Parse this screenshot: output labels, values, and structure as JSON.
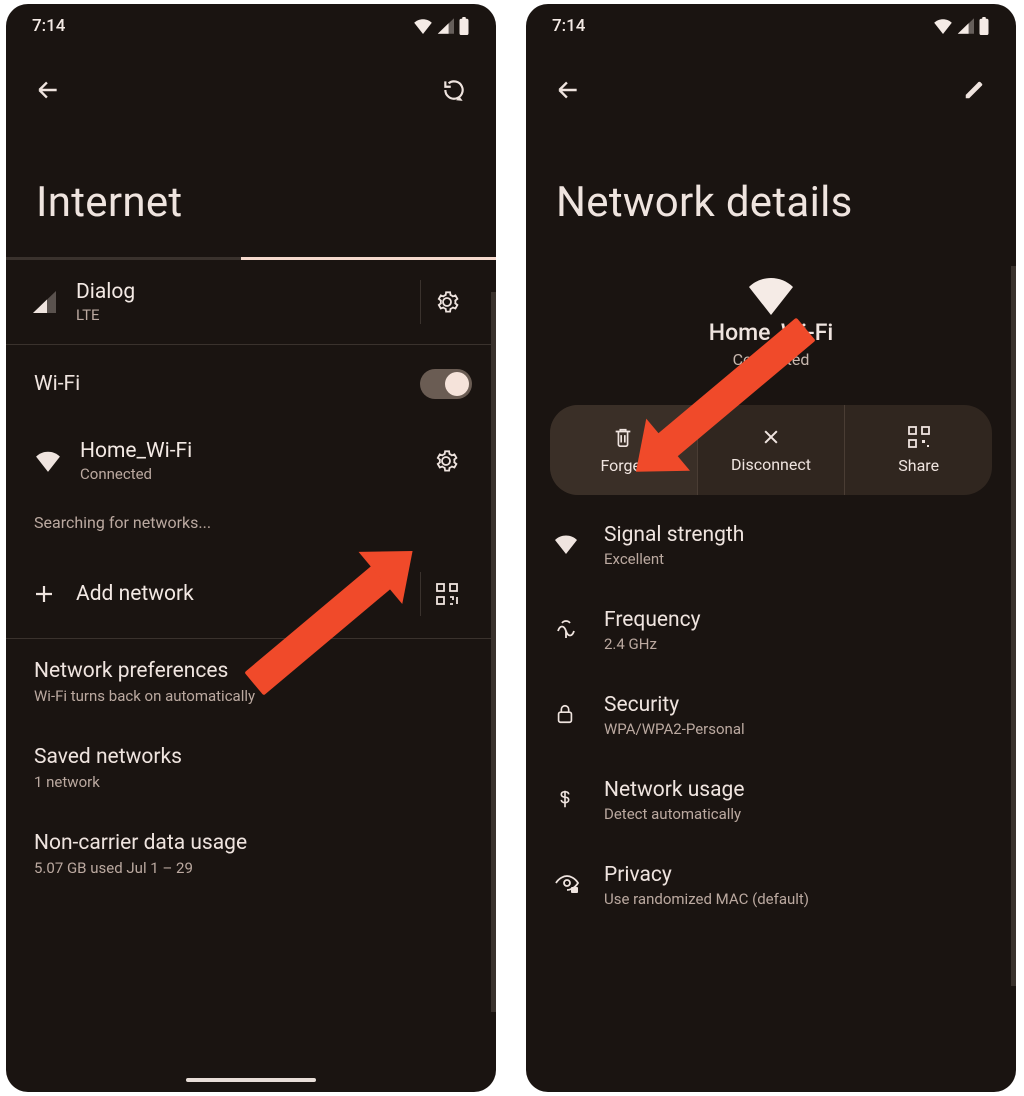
{
  "status": {
    "time": "7:14"
  },
  "left": {
    "title": "Internet",
    "carrier": {
      "name": "Dialog",
      "tech": "LTE"
    },
    "wifi_label": "Wi-Fi",
    "connected": {
      "ssid": "Home_Wi-Fi",
      "status": "Connected"
    },
    "searching": "Searching for networks...",
    "add_network": "Add network",
    "prefs": [
      {
        "title": "Network preferences",
        "sub": "Wi-Fi turns back on automatically"
      },
      {
        "title": "Saved networks",
        "sub": "1 network"
      },
      {
        "title": "Non-carrier data usage",
        "sub": "5.07 GB used Jul 1 – 29"
      }
    ]
  },
  "right": {
    "title": "Network details",
    "ssid": "Home_Wi-Fi",
    "status": "Connected",
    "actions": {
      "forget": "Forget",
      "disconnect": "Disconnect",
      "share": "Share"
    },
    "details": [
      {
        "title": "Signal strength",
        "sub": "Excellent"
      },
      {
        "title": "Frequency",
        "sub": "2.4 GHz"
      },
      {
        "title": "Security",
        "sub": "WPA/WPA2-Personal"
      },
      {
        "title": "Network usage",
        "sub": "Detect automatically"
      },
      {
        "title": "Privacy",
        "sub": "Use randomized MAC (default)"
      }
    ]
  }
}
